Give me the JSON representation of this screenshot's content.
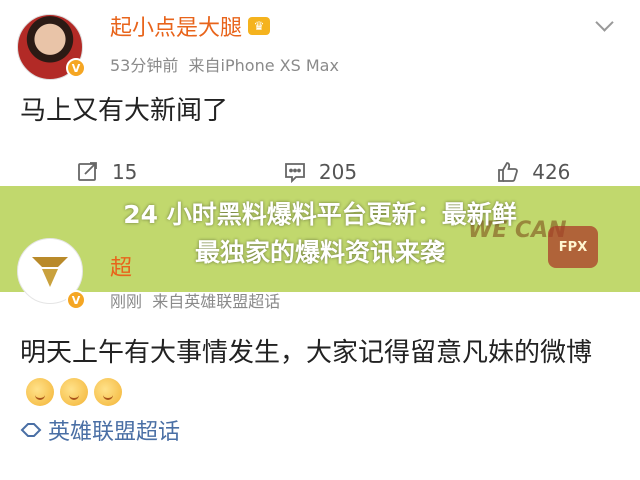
{
  "post1": {
    "author": "起小点是大腿",
    "time": "53分钟前",
    "source": "来自iPhone XS Max",
    "text": "马上又有大新闻了",
    "actions": {
      "repost": "15",
      "comment": "205",
      "like": "426"
    }
  },
  "banner": {
    "headline_line1": "24 小时黑料爆料平台更新：最新鲜",
    "headline_line2": "最独家的爆料资讯来袭",
    "color": "#b0cd44"
  },
  "post2": {
    "author": "超",
    "time": "刚刚",
    "source": "来自英雄联盟超话",
    "text": "明天上午有大事情发生，大家记得留意凡妹的微博",
    "topic": "英雄联盟超话"
  },
  "background_text": {
    "we_can": "WE CAN",
    "fpx": "FPX"
  },
  "colors": {
    "username": "#e8641b",
    "meta": "#8a8a8a",
    "topic": "#4a6fa5",
    "verify_badge": "#f5a623"
  },
  "icons": [
    "crown-icon",
    "chevron-down-icon",
    "repost-icon",
    "comment-icon",
    "like-icon",
    "emoji-icon",
    "supertopic-icon"
  ]
}
